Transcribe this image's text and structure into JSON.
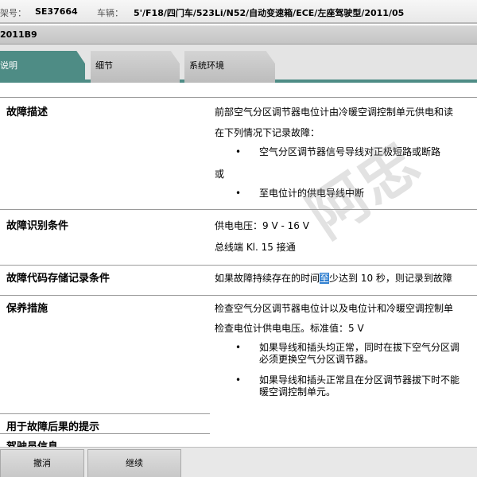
{
  "header": {
    "chassis_label": "架号：",
    "chassis_value": "SE37664",
    "vehicle_label": "车辆：",
    "vehicle_value": "5'/F18/四门车/523Li/N52/自动变速箱/ECE/左座驾驶型/2011/05"
  },
  "code_bar": {
    "text": "2011B9"
  },
  "tabs": [
    {
      "label": "说明",
      "active": true
    },
    {
      "label": "细节",
      "active": false
    },
    {
      "label": "系统环境",
      "active": false
    }
  ],
  "sections": {
    "fault_description": {
      "title": "故障描述",
      "line1": "前部空气分区调节器电位计由冷暖空调控制单元供电和读",
      "line2": "在下列情况下记录故障：",
      "bullet1": "空气分区调节器信号导线对正极短路或断路",
      "or_text": "或",
      "bullet2": "至电位计的供电导线中断"
    },
    "identification": {
      "title": "故障识别条件",
      "line1": "供电电压：9 V - 16 V",
      "line2": "总线端 Kl. 15 接通"
    },
    "storage": {
      "title": "故障代码存储记录条件",
      "text_before": "如果故障持续存在的时间",
      "text_highlight": "至",
      "text_after": "少达到  10 秒，则记录到故障"
    },
    "maintenance": {
      "title": "保养措施",
      "line1": "检查空气分区调节器电位计以及电位计和冷暖空调控制单",
      "line2": "检查电位计供电电压。标准值：5 V",
      "bullet1_l1": "如果导线和插头均正常，同时在拔下空气分区调",
      "bullet1_l2": "必须更换空气分区调节器。",
      "bullet2_l1": "如果导线和插头正常且在分区调节器拔下时不能",
      "bullet2_l2": "暖空调控制单元。"
    },
    "consequence": {
      "title": "用于故障后果的提示"
    },
    "extra": {
      "title": "驾驶员信息"
    }
  },
  "watermark": {
    "text": "阿忠"
  },
  "buttons": {
    "cancel": "撤消",
    "continue": "继续"
  },
  "colors": {
    "accent": "#4e8c85",
    "highlight": "#2f7fd0"
  }
}
